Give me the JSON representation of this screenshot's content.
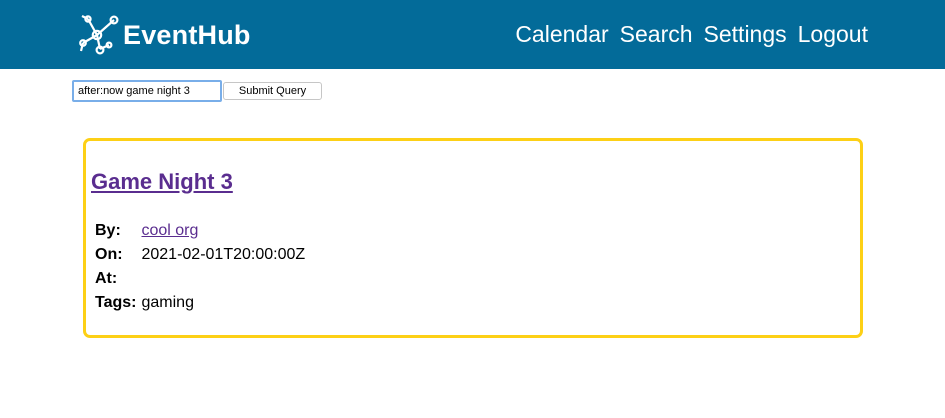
{
  "header": {
    "brand": "EventHub",
    "nav": [
      "Calendar",
      "Search",
      "Settings",
      "Logout"
    ],
    "background_color": "#036b99",
    "logo_icon": "network-nodes-icon"
  },
  "search": {
    "query_value": "after:now game night 3",
    "submit_label": "Submit Query"
  },
  "event": {
    "title": "Game Night 3",
    "by_label": "By:",
    "by_value": "cool org",
    "on_label": "On:",
    "on_value": "2021-02-01T20:00:00Z",
    "at_label": "At:",
    "at_value": "",
    "tags_label": "Tags:",
    "tags_value": "gaming",
    "border_color": "#fdd016",
    "link_color": "#5a2d8f"
  }
}
